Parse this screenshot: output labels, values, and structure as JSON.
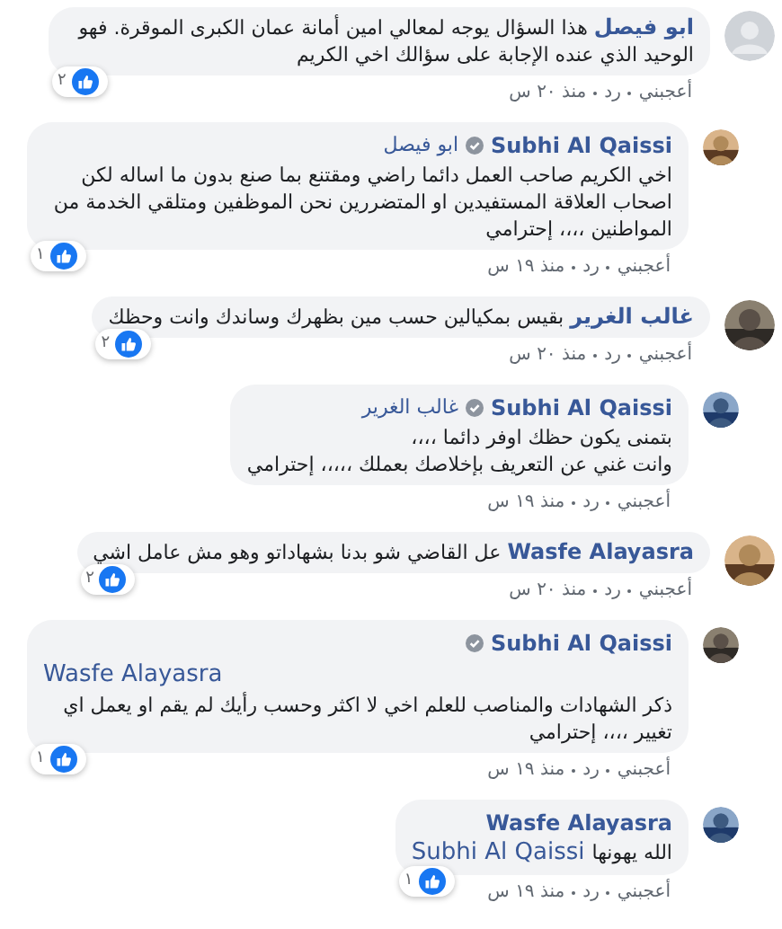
{
  "comments": [
    {
      "reply": false,
      "default_avatar": true,
      "author": "ابو فيصل",
      "verified": false,
      "text": "هذا السؤال يوجه لمعالي امين أمانة عمان الكبرى الموقرة. فهو الوحيد الذي عنده الإجابة على سؤالك اخي الكريم",
      "likes": "٢",
      "like_link": "أعجبني",
      "reply_link": "رد",
      "time": "منذ ٢٠ س"
    },
    {
      "reply": true,
      "default_avatar": false,
      "author": "Subhi Al Qaissi",
      "verified": true,
      "header_mention": "ابو فيصل",
      "text": "اخي الكريم صاحب العمل دائما راضي ومقتنع بما صنع بدون ما اساله لكن اصحاب العلاقة المستفيدين او المتضررين نحن الموظفين ومتلقي الخدمة من المواطنين ،،،، إحترامي",
      "likes": "١",
      "like_link": "أعجبني",
      "reply_link": "رد",
      "time": "منذ ١٩ س"
    },
    {
      "reply": false,
      "default_avatar": false,
      "author": "غالب الغرير",
      "verified": false,
      "text": "بقيس بمكيالين حسب مين بظهرك وساندك وانت وحظك",
      "likes": "٢",
      "like_link": "أعجبني",
      "reply_link": "رد",
      "time": "منذ ٢٠ س"
    },
    {
      "reply": true,
      "default_avatar": false,
      "author": "Subhi Al Qaissi",
      "verified": true,
      "header_mention": "غالب الغرير",
      "lines": [
        "بتمنى يكون حظك اوفر دائما ،،،،",
        "وانت غني عن التعريف بإخلاصك بعملك ،،،،، إحترامي"
      ],
      "like_link": "أعجبني",
      "reply_link": "رد",
      "time": "منذ ١٩ س"
    },
    {
      "reply": false,
      "default_avatar": false,
      "author": "Wasfe Alayasra",
      "verified": false,
      "text": "عل القاضي شو بدنا بشهاداتو وهو مش عامل اشي",
      "likes": "٢",
      "like_link": "أعجبني",
      "reply_link": "رد",
      "time": "منذ ٢٠ س"
    },
    {
      "reply": true,
      "default_avatar": false,
      "author": "Subhi Al Qaissi",
      "verified": true,
      "line_mention": "Wasfe Alayasra",
      "text": "ذكر الشهادات والمناصب للعلم اخي لا اكثر وحسب رأيك لم يقم او يعمل اي تغيير ،،،، إحترامي",
      "likes": "١",
      "like_link": "أعجبني",
      "reply_link": "رد",
      "time": "منذ ١٩ س"
    },
    {
      "reply": true,
      "default_avatar": false,
      "author": "Wasfe Alayasra",
      "verified": false,
      "text": "الله يهونها",
      "trailing_mention": "Subhi Al Qaissi",
      "likes": "١",
      "like_link": "أعجبني",
      "reply_link": "رد",
      "time": "منذ ١٩ س"
    }
  ]
}
